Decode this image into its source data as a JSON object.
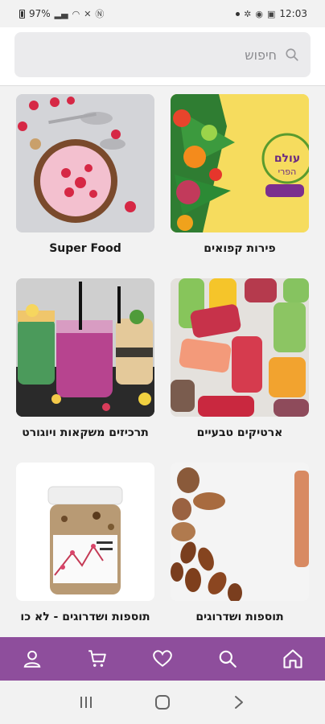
{
  "status_bar": {
    "battery": "97%",
    "time": "12:03"
  },
  "search": {
    "placeholder": "חיפוש"
  },
  "categories": [
    {
      "label": "פירות קפואים",
      "image": "tropical-fruits-photo"
    },
    {
      "label": "Super Food",
      "image": "smoothie-bowl-photo"
    },
    {
      "label": "ארטיקים טבעיים",
      "image": "fruit-popsicles-photo"
    },
    {
      "label": "תרכיזים משקאות ויוגורט",
      "image": "smoothie-drinks-photo"
    },
    {
      "label": "תוספות ושדרוגים",
      "image": "nuts-photo"
    },
    {
      "label": "תוספות ושדרוגים - לא כו",
      "image": "granola-jar-photo"
    }
  ],
  "bottom_nav": [
    "home-icon",
    "search-icon",
    "heart-icon",
    "cart-icon",
    "user-icon"
  ],
  "colors": {
    "nav_bg": "#8e4e9c",
    "screen_bg": "#f2f2f2",
    "search_bg": "#ebebed"
  }
}
